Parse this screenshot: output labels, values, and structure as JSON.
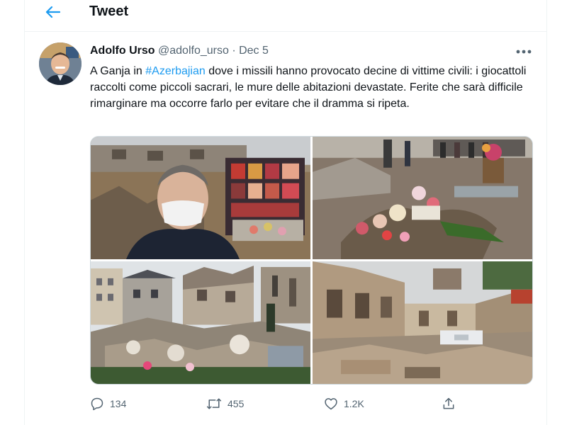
{
  "header": {
    "title": "Tweet",
    "back_icon": "arrow-left-icon"
  },
  "tweet": {
    "author_name": "Adolfo Urso",
    "handle": "@adolfo_urso",
    "separator": "·",
    "date": "Dec 5",
    "more_icon": "more-horizontal-icon",
    "text_before": "A Ganja in ",
    "hashtag": "#Azerbajian",
    "text_after": " dove i missili hanno provocato decine di vittime civili: i giocattoli raccolti come piccoli sacrari, le mure delle abitazioni devastate. Ferite che sarà difficile rimarginare ma occorre farlo per evitare che il dramma si ripeta."
  },
  "actions": {
    "reply_count": "134",
    "retweet_count": "455",
    "like_count": "1.2K",
    "reply_icon": "reply-icon",
    "retweet_icon": "retweet-icon",
    "like_icon": "heart-icon",
    "share_icon": "share-icon"
  },
  "colors": {
    "accent": "#1d9bf0",
    "text": "#0f1419",
    "muted": "#536471",
    "border": "#eff3f4"
  }
}
